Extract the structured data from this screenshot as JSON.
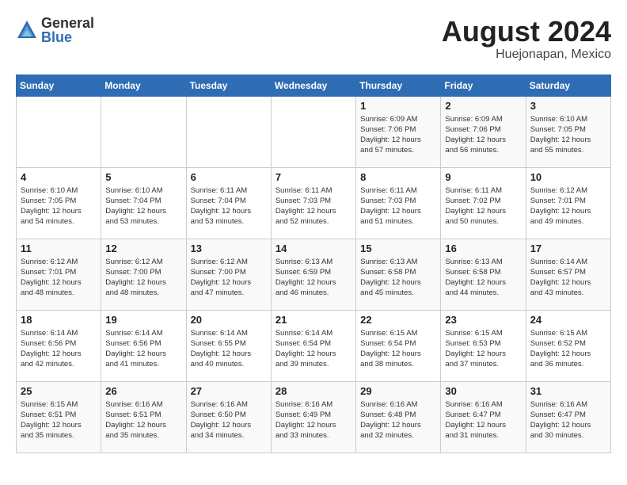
{
  "logo": {
    "general": "General",
    "blue": "Blue"
  },
  "title": {
    "month_year": "August 2024",
    "location": "Huejonapan, Mexico"
  },
  "headers": [
    "Sunday",
    "Monday",
    "Tuesday",
    "Wednesday",
    "Thursday",
    "Friday",
    "Saturday"
  ],
  "weeks": [
    [
      {
        "day": "",
        "info": ""
      },
      {
        "day": "",
        "info": ""
      },
      {
        "day": "",
        "info": ""
      },
      {
        "day": "",
        "info": ""
      },
      {
        "day": "1",
        "info": "Sunrise: 6:09 AM\nSunset: 7:06 PM\nDaylight: 12 hours\nand 57 minutes."
      },
      {
        "day": "2",
        "info": "Sunrise: 6:09 AM\nSunset: 7:06 PM\nDaylight: 12 hours\nand 56 minutes."
      },
      {
        "day": "3",
        "info": "Sunrise: 6:10 AM\nSunset: 7:05 PM\nDaylight: 12 hours\nand 55 minutes."
      }
    ],
    [
      {
        "day": "4",
        "info": "Sunrise: 6:10 AM\nSunset: 7:05 PM\nDaylight: 12 hours\nand 54 minutes."
      },
      {
        "day": "5",
        "info": "Sunrise: 6:10 AM\nSunset: 7:04 PM\nDaylight: 12 hours\nand 53 minutes."
      },
      {
        "day": "6",
        "info": "Sunrise: 6:11 AM\nSunset: 7:04 PM\nDaylight: 12 hours\nand 53 minutes."
      },
      {
        "day": "7",
        "info": "Sunrise: 6:11 AM\nSunset: 7:03 PM\nDaylight: 12 hours\nand 52 minutes."
      },
      {
        "day": "8",
        "info": "Sunrise: 6:11 AM\nSunset: 7:03 PM\nDaylight: 12 hours\nand 51 minutes."
      },
      {
        "day": "9",
        "info": "Sunrise: 6:11 AM\nSunset: 7:02 PM\nDaylight: 12 hours\nand 50 minutes."
      },
      {
        "day": "10",
        "info": "Sunrise: 6:12 AM\nSunset: 7:01 PM\nDaylight: 12 hours\nand 49 minutes."
      }
    ],
    [
      {
        "day": "11",
        "info": "Sunrise: 6:12 AM\nSunset: 7:01 PM\nDaylight: 12 hours\nand 48 minutes."
      },
      {
        "day": "12",
        "info": "Sunrise: 6:12 AM\nSunset: 7:00 PM\nDaylight: 12 hours\nand 48 minutes."
      },
      {
        "day": "13",
        "info": "Sunrise: 6:12 AM\nSunset: 7:00 PM\nDaylight: 12 hours\nand 47 minutes."
      },
      {
        "day": "14",
        "info": "Sunrise: 6:13 AM\nSunset: 6:59 PM\nDaylight: 12 hours\nand 46 minutes."
      },
      {
        "day": "15",
        "info": "Sunrise: 6:13 AM\nSunset: 6:58 PM\nDaylight: 12 hours\nand 45 minutes."
      },
      {
        "day": "16",
        "info": "Sunrise: 6:13 AM\nSunset: 6:58 PM\nDaylight: 12 hours\nand 44 minutes."
      },
      {
        "day": "17",
        "info": "Sunrise: 6:14 AM\nSunset: 6:57 PM\nDaylight: 12 hours\nand 43 minutes."
      }
    ],
    [
      {
        "day": "18",
        "info": "Sunrise: 6:14 AM\nSunset: 6:56 PM\nDaylight: 12 hours\nand 42 minutes."
      },
      {
        "day": "19",
        "info": "Sunrise: 6:14 AM\nSunset: 6:56 PM\nDaylight: 12 hours\nand 41 minutes."
      },
      {
        "day": "20",
        "info": "Sunrise: 6:14 AM\nSunset: 6:55 PM\nDaylight: 12 hours\nand 40 minutes."
      },
      {
        "day": "21",
        "info": "Sunrise: 6:14 AM\nSunset: 6:54 PM\nDaylight: 12 hours\nand 39 minutes."
      },
      {
        "day": "22",
        "info": "Sunrise: 6:15 AM\nSunset: 6:54 PM\nDaylight: 12 hours\nand 38 minutes."
      },
      {
        "day": "23",
        "info": "Sunrise: 6:15 AM\nSunset: 6:53 PM\nDaylight: 12 hours\nand 37 minutes."
      },
      {
        "day": "24",
        "info": "Sunrise: 6:15 AM\nSunset: 6:52 PM\nDaylight: 12 hours\nand 36 minutes."
      }
    ],
    [
      {
        "day": "25",
        "info": "Sunrise: 6:15 AM\nSunset: 6:51 PM\nDaylight: 12 hours\nand 35 minutes."
      },
      {
        "day": "26",
        "info": "Sunrise: 6:16 AM\nSunset: 6:51 PM\nDaylight: 12 hours\nand 35 minutes."
      },
      {
        "day": "27",
        "info": "Sunrise: 6:16 AM\nSunset: 6:50 PM\nDaylight: 12 hours\nand 34 minutes."
      },
      {
        "day": "28",
        "info": "Sunrise: 6:16 AM\nSunset: 6:49 PM\nDaylight: 12 hours\nand 33 minutes."
      },
      {
        "day": "29",
        "info": "Sunrise: 6:16 AM\nSunset: 6:48 PM\nDaylight: 12 hours\nand 32 minutes."
      },
      {
        "day": "30",
        "info": "Sunrise: 6:16 AM\nSunset: 6:47 PM\nDaylight: 12 hours\nand 31 minutes."
      },
      {
        "day": "31",
        "info": "Sunrise: 6:16 AM\nSunset: 6:47 PM\nDaylight: 12 hours\nand 30 minutes."
      }
    ]
  ]
}
